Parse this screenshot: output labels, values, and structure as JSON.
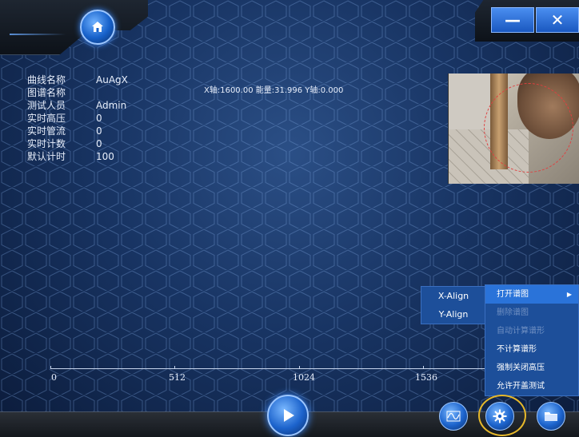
{
  "info": {
    "rows": [
      {
        "label": "曲线名称",
        "value": "AuAgX"
      },
      {
        "label": "图谱名称",
        "value": ""
      },
      {
        "label": "测试人员",
        "value": "Admin"
      },
      {
        "label": "实时高压",
        "value": "0"
      },
      {
        "label": "实时管流",
        "value": "0"
      },
      {
        "label": "实时计数",
        "value": "0"
      },
      {
        "label": "默认计时",
        "value": "100"
      }
    ]
  },
  "readout": "X轴:1600.00 能量:31.996 Y轴:0.000",
  "axis": {
    "ticks": [
      "0",
      "512",
      "1024",
      "1536"
    ]
  },
  "align_menu": {
    "items": [
      "X-Align",
      "Y-Align"
    ]
  },
  "context_menu": {
    "items": [
      {
        "label": "打开谱图",
        "state": "active"
      },
      {
        "label": "删除谱图",
        "state": "disabled"
      },
      {
        "label": "自动计算谱形",
        "state": "disabled"
      },
      {
        "label": "不计算谱形",
        "state": "normal"
      },
      {
        "label": "强制关闭高压",
        "state": "normal"
      },
      {
        "label": "允许开盖测试",
        "state": "normal"
      }
    ]
  },
  "window_controls": {
    "minimize": "—",
    "close": "✕"
  },
  "icons": {
    "home": "home-icon",
    "play": "play-icon",
    "wave": "wave-icon",
    "gear": "gear-icon",
    "folder": "folder-icon"
  },
  "colors": {
    "accent": "#1c63cc",
    "highlight_ring": "#e6b82a",
    "menu_bg": "#1d4f9a"
  }
}
